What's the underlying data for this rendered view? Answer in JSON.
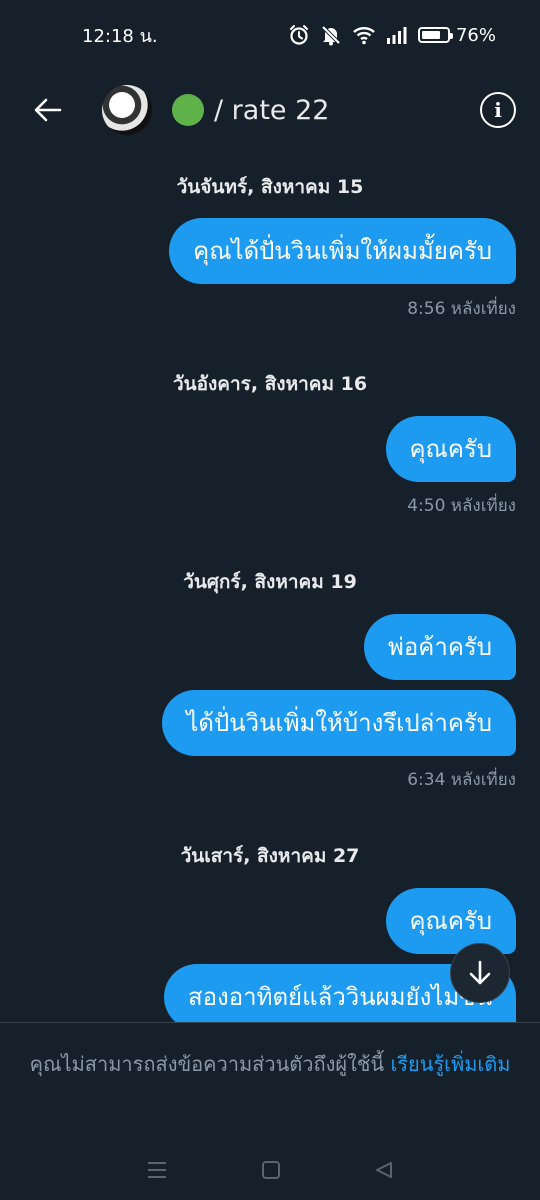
{
  "status_bar": {
    "time": "12:18 น.",
    "battery_percent": "76%",
    "battery_level": 0.76,
    "icons": [
      "alarm-icon",
      "bell-muted-icon",
      "wifi-icon",
      "signal-icon",
      "battery-icon"
    ]
  },
  "header": {
    "title": "/ rate 22",
    "status_dot_color": "#5fb14a",
    "back_icon": "arrow-left-icon",
    "info_icon": "info-icon",
    "info_glyph": "i"
  },
  "conversation": [
    {
      "date": "วันจันทร์, สิงหาคม 15",
      "messages": [
        "คุณได้ปั่นวินเพิ่มให้ผมมั้ยครับ"
      ],
      "time": "8:56 หลังเที่ยง"
    },
    {
      "date": "วันอังคาร, สิงหาคม 16",
      "messages": [
        "คุณครับ"
      ],
      "time": "4:50 หลังเที่ยง"
    },
    {
      "date": "วันศุกร์, สิงหาคม 19",
      "messages": [
        "พ่อค้าครับ",
        "ได้ปั่นวินเพิ่มให้บ้างรึเปล่าครับ"
      ],
      "time": "6:34 หลังเที่ยง"
    },
    {
      "date": "วันเสาร์, สิงหาคม 27",
      "messages": [
        "คุณครับ",
        "สองอาทิตย์แล้ววินผมยังไม่ขึ้น"
      ],
      "time": ""
    }
  ],
  "compose_notice": {
    "text": "คุณไม่สามารถส่งข้อความส่วนตัวถึงผู้ใช้นี้ ",
    "link": "เรียนรู้เพิ่มเติม"
  },
  "colors": {
    "background": "#15202b",
    "bubble": "#1d9bf0",
    "muted_text": "#8b98a5",
    "link": "#1d9bf0"
  },
  "nav_bar": {
    "icons": [
      "menu-icon",
      "home-square-icon",
      "back-triangle-icon"
    ]
  }
}
